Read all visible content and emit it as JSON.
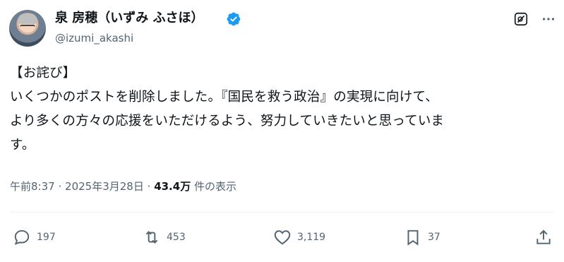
{
  "author": {
    "display_name": "泉 房穂（いずみ ふさほ）",
    "handle": "@izumi_akashi",
    "verified_icon": "verified-badge-icon",
    "verified_color": "#1d9bf0"
  },
  "post": {
    "text": "【お詫び】\nいくつかのポストを削除しました。『国民を救う政治』の実現に向けて、\nより多くの方々の応援をいただけるよう、努力していきたいと思っていま\nす。",
    "time": "午前8:37",
    "separator": "·",
    "date": "2025年3月28日",
    "views_count": "43.4万",
    "views_label": "件の表示"
  },
  "actions": {
    "reply_count": "197",
    "repost_count": "453",
    "like_count": "3,119",
    "bookmark_count": "37"
  },
  "colors": {
    "text": "#0f1419",
    "secondary": "#536471",
    "divider": "#eff3f4",
    "accent": "#1d9bf0"
  }
}
